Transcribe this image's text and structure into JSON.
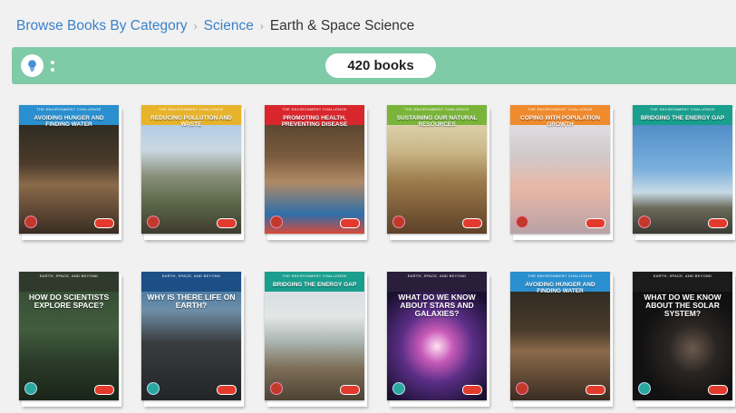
{
  "breadcrumb": {
    "items": [
      "Browse Books By Category",
      "Science"
    ],
    "separator": "›",
    "current": "Earth & Space Science"
  },
  "toolbar": {
    "filter_icon": "lightbulb-icon",
    "more_icon": "vertical-dots-icon",
    "count_label": "420 books"
  },
  "colors": {
    "link": "#3b82c9",
    "toolbar": "#7fcaa7",
    "logo_red": "#e23b2e"
  },
  "books": [
    {
      "series": "The Environment Challenge",
      "title": "Avoiding Hunger and Finding Water",
      "band": "#2a8fcf",
      "art": "hands-water"
    },
    {
      "series": "The Environment Challenge",
      "title": "Reducing Pollution and Waste",
      "band": "#e7b32b",
      "art": "landfill"
    },
    {
      "series": "The Environment Challenge",
      "title": "Promoting Health, Preventing Disease",
      "band": "#d8262c",
      "art": "children"
    },
    {
      "series": "The Environment Challenge",
      "title": "Sustaining our Natural Resources",
      "band": "#7ab43a",
      "art": "seedling"
    },
    {
      "series": "The Environment Challenge",
      "title": "Coping with Population Growth",
      "band": "#ef8a2d",
      "art": "babies"
    },
    {
      "series": "The Environment Challenge",
      "title": "Bridging the Energy Gap",
      "band": "#1a9e8e",
      "art": "wind-turbine"
    },
    {
      "series": "Earth, Space, and Beyond",
      "title": "How do Scientists Explore Space?",
      "band": "#2f3a2c",
      "art": "telescope"
    },
    {
      "series": "Earth, Space, and Beyond",
      "title": "Why is there Life on Earth?",
      "band": "#1c4f86",
      "art": "lava"
    },
    {
      "series": "The Environment Challenge",
      "title": "Bridging the Energy Gap",
      "band": "#1a9e8e",
      "art": "shore"
    },
    {
      "series": "Earth, Space, and Beyond",
      "title": "What do we know about Stars and Galaxies?",
      "band": "#2a1e3a",
      "art": "galaxy"
    },
    {
      "series": "The Environment Challenge",
      "title": "Avoiding Hunger and Finding Water",
      "band": "#2a8fcf",
      "art": "hands-water"
    },
    {
      "series": "Earth, Space, and Beyond",
      "title": "What do we know about The Solar System?",
      "band": "#1b1b1b",
      "art": "planets"
    }
  ]
}
